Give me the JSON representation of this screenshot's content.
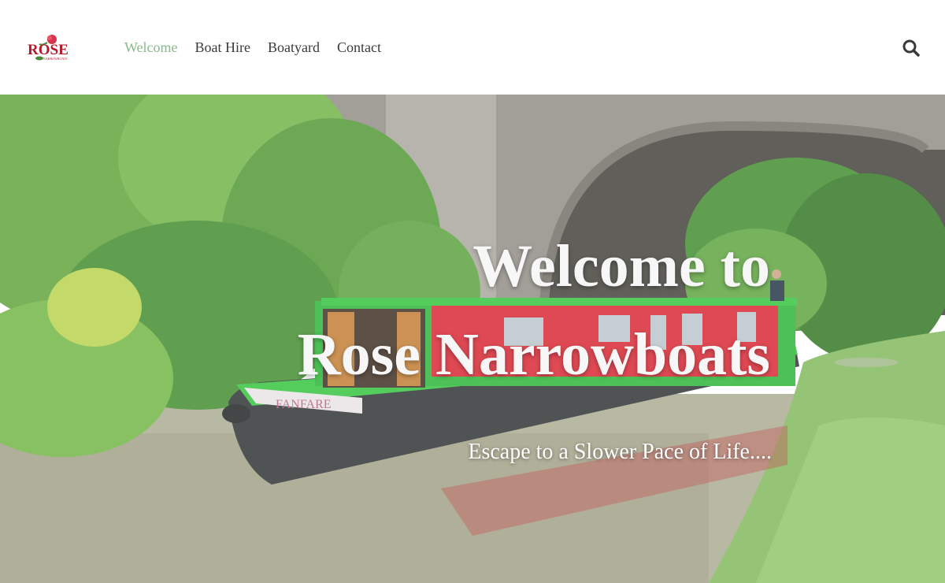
{
  "header": {
    "logo": {
      "title": "ROSE",
      "subtitle": "NARROWBOATS"
    },
    "nav": [
      {
        "label": "Welcome",
        "active": true
      },
      {
        "label": "Boat Hire",
        "active": false
      },
      {
        "label": "Boatyard",
        "active": false
      },
      {
        "label": "Contact",
        "active": false
      }
    ],
    "search_icon": "search-icon"
  },
  "hero": {
    "headline_line1": "Welcome to",
    "headline_line2": "Rose Narrowboats",
    "tagline": "Escape to a Slower Pace of Life....",
    "boat_name": "FANFARE"
  },
  "colors": {
    "nav_active": "#8ab98b",
    "nav_text": "#3a3a3a",
    "boat_green": "#2fc23a",
    "boat_red": "#d8222e"
  }
}
